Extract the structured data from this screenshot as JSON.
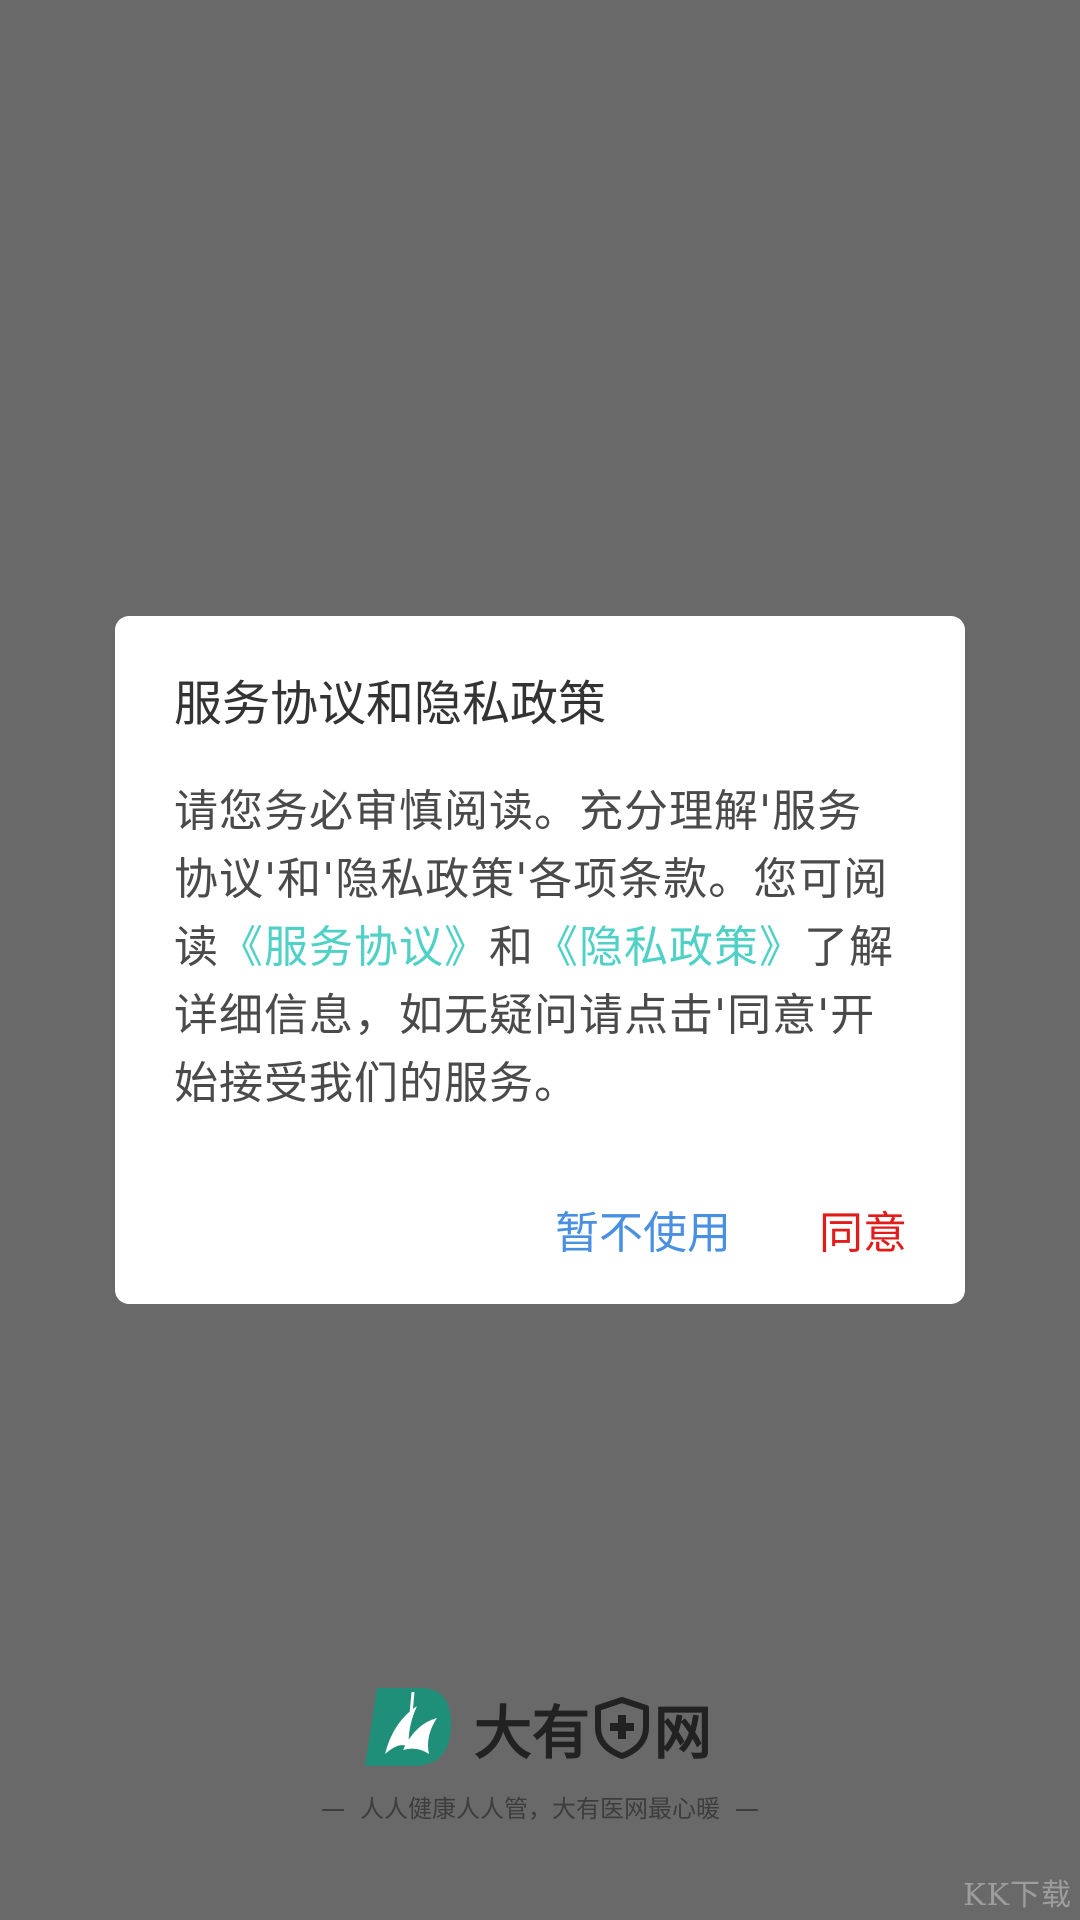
{
  "dialog": {
    "title": "服务协议和隐私政策",
    "body_part1": "请您务必审慎阅读。充分理解'服务协议'和'隐私政策'各项条款。您可阅读",
    "service_link": "《服务协议》",
    "body_and": "和",
    "privacy_link": "《隐私政策》",
    "body_part2": "了解详细信息，如无疑问请点击'同意'开始接受我们的服务。",
    "decline_label": "暂不使用",
    "agree_label": "同意"
  },
  "brand": {
    "name_part1": "大有",
    "name_part2": "网",
    "slogan": "人人健康人人管，大有医网最心暖"
  },
  "watermark": "KK下载",
  "colors": {
    "overlay": "#696969",
    "link": "#4fd1c5",
    "decline": "#4a90e2",
    "agree": "#e21b1b",
    "logo": "#1f8f7a"
  }
}
